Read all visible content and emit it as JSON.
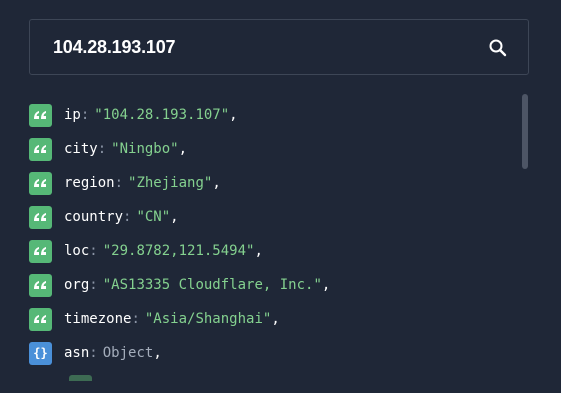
{
  "search": {
    "value": "104.28.193.107"
  },
  "icons": {
    "search": "search-icon",
    "string": "quote-icon",
    "object": "braces-icon"
  },
  "colors": {
    "background": "#1f2737",
    "string_badge": "#56b877",
    "object_badge": "#4a90d9",
    "string_value": "#84d18f",
    "key": "#ffffff"
  },
  "rows": [
    {
      "key": "ip",
      "value": "\"104.28.193.107\"",
      "type": "string",
      "comma": ","
    },
    {
      "key": "city",
      "value": "\"Ningbo\"",
      "type": "string",
      "comma": ","
    },
    {
      "key": "region",
      "value": "\"Zhejiang\"",
      "type": "string",
      "comma": ","
    },
    {
      "key": "country",
      "value": "\"CN\"",
      "type": "string",
      "comma": ","
    },
    {
      "key": "loc",
      "value": "\"29.8782,121.5494\"",
      "type": "string",
      "comma": ","
    },
    {
      "key": "org",
      "value": "\"AS13335 Cloudflare, Inc.\"",
      "type": "string",
      "comma": ","
    },
    {
      "key": "timezone",
      "value": "\"Asia/Shanghai\"",
      "type": "string",
      "comma": ","
    },
    {
      "key": "asn",
      "value": "Object",
      "type": "object",
      "comma": ","
    }
  ],
  "syntax": {
    "colon": ":",
    "brace": "{}"
  }
}
